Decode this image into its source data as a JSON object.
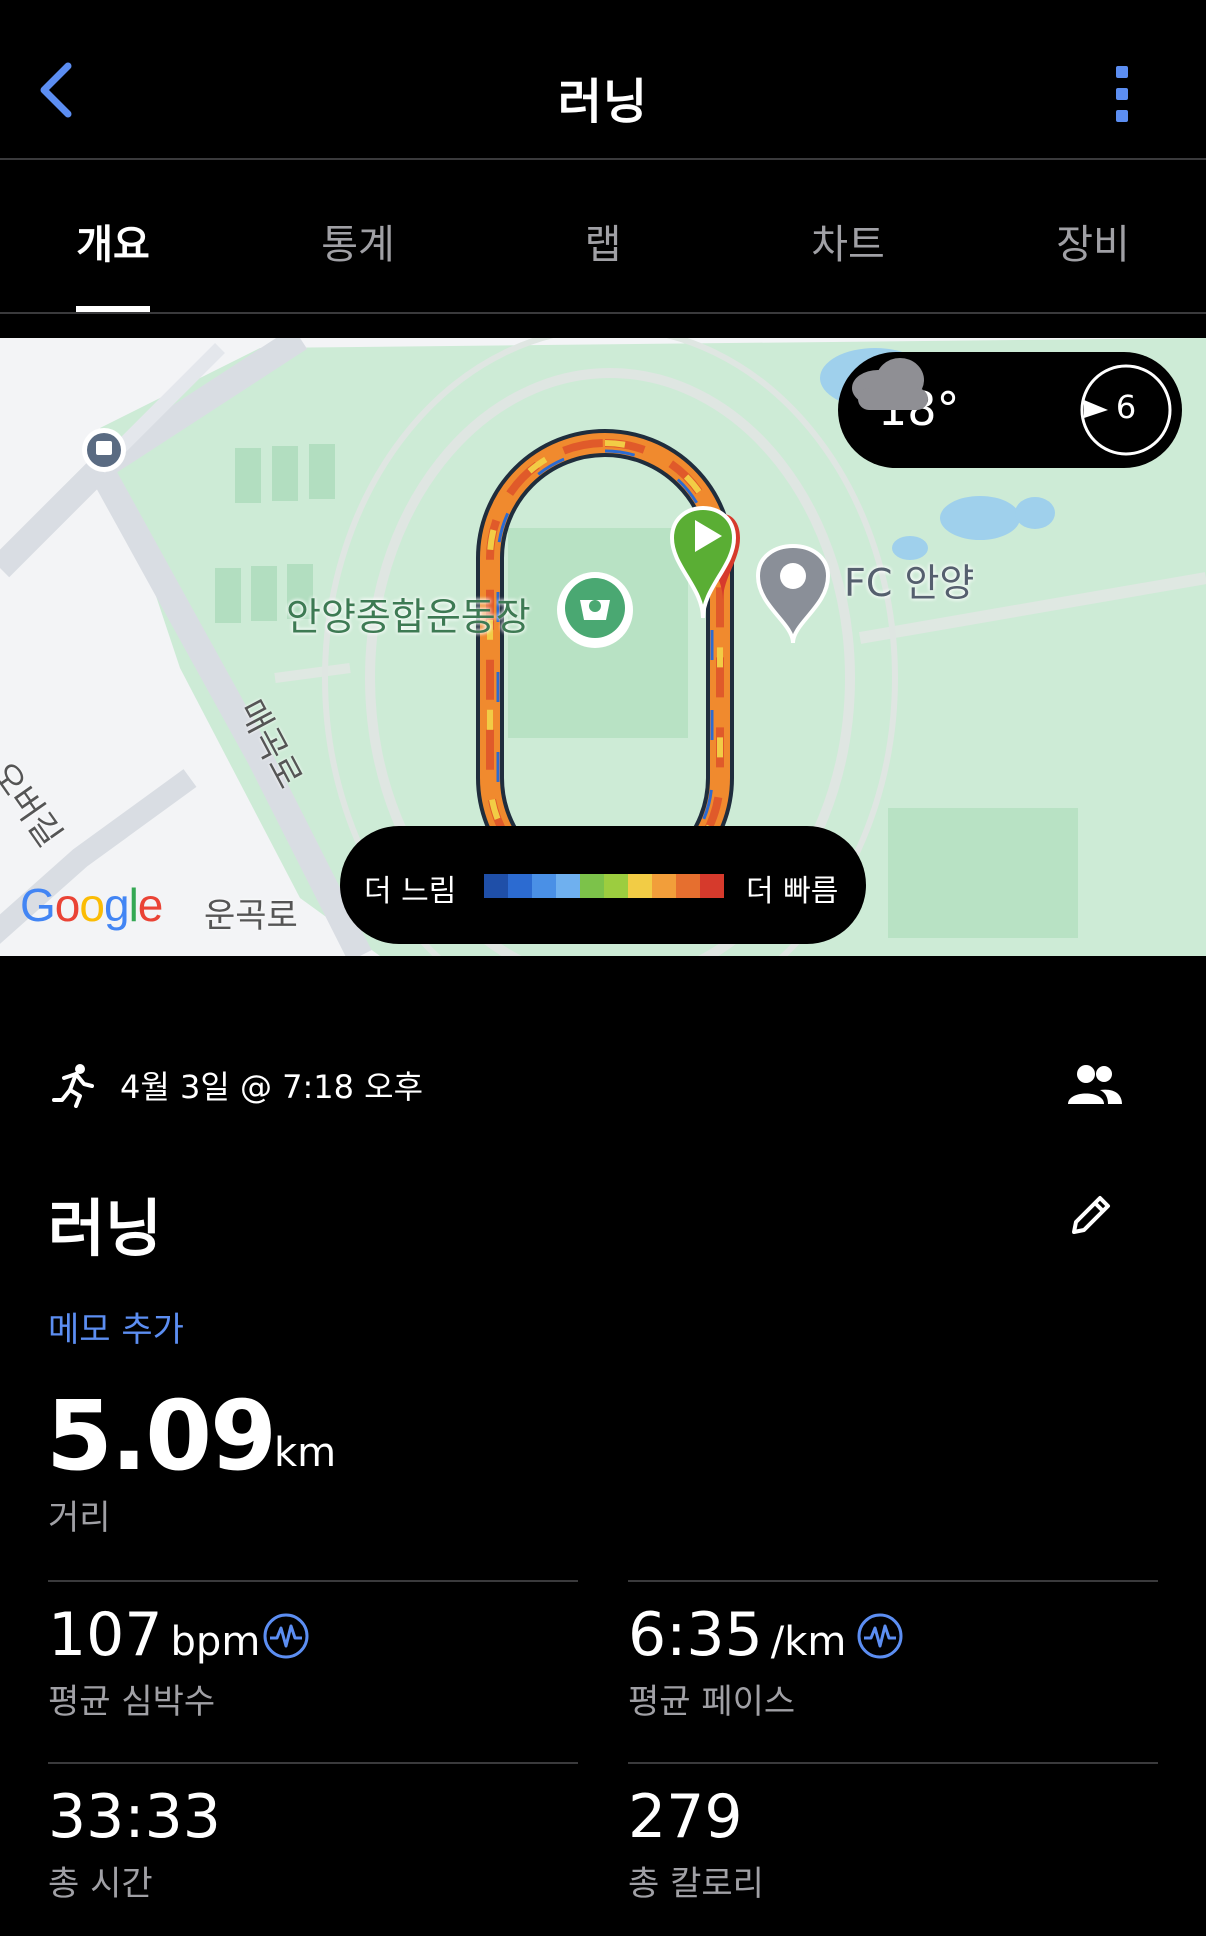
{
  "header": {
    "title": "러닝"
  },
  "tabs": [
    {
      "label": "개요",
      "active": true
    },
    {
      "label": "통계",
      "active": false
    },
    {
      "label": "랩",
      "active": false
    },
    {
      "label": "차트",
      "active": false
    },
    {
      "label": "장비",
      "active": false
    }
  ],
  "map": {
    "weather": {
      "temp": "18°",
      "wind": "6",
      "icons": [
        "cloud-icon",
        "wind-direction-icon"
      ]
    },
    "legend": {
      "slow": "더 느림",
      "fast": "더 빠름",
      "colors": [
        "#1f4fa8",
        "#2c6bd1",
        "#4a90e6",
        "#6fb0ef",
        "#7cc24a",
        "#9ccd3f",
        "#f2cc45",
        "#f29e3a",
        "#e66f2f",
        "#d63a2c"
      ]
    },
    "labels": {
      "stadium": "안양종합운동장",
      "fc": "FC 안양",
      "road1": "매곡로",
      "road2": "운곡로",
      "road3": "오버길"
    },
    "google": [
      "G",
      "o",
      "o",
      "g",
      "l",
      "e"
    ]
  },
  "activity": {
    "date": "4월 3일 @ 7:18 오후",
    "name": "러닝",
    "add_memo": "메모 추가",
    "distance": {
      "value": "5.09",
      "unit": "km",
      "label": "거리"
    },
    "stats": [
      {
        "value": "107",
        "unit": "bpm",
        "label": "평균 심박수",
        "has_icon": true
      },
      {
        "value": "6:35",
        "unit": "/km",
        "label": "평균 페이스",
        "has_icon": true
      },
      {
        "value": "33:33",
        "unit": "",
        "label": "총 시간",
        "has_icon": false
      },
      {
        "value": "279",
        "unit": "",
        "label": "총 칼로리",
        "has_icon": false
      }
    ]
  }
}
